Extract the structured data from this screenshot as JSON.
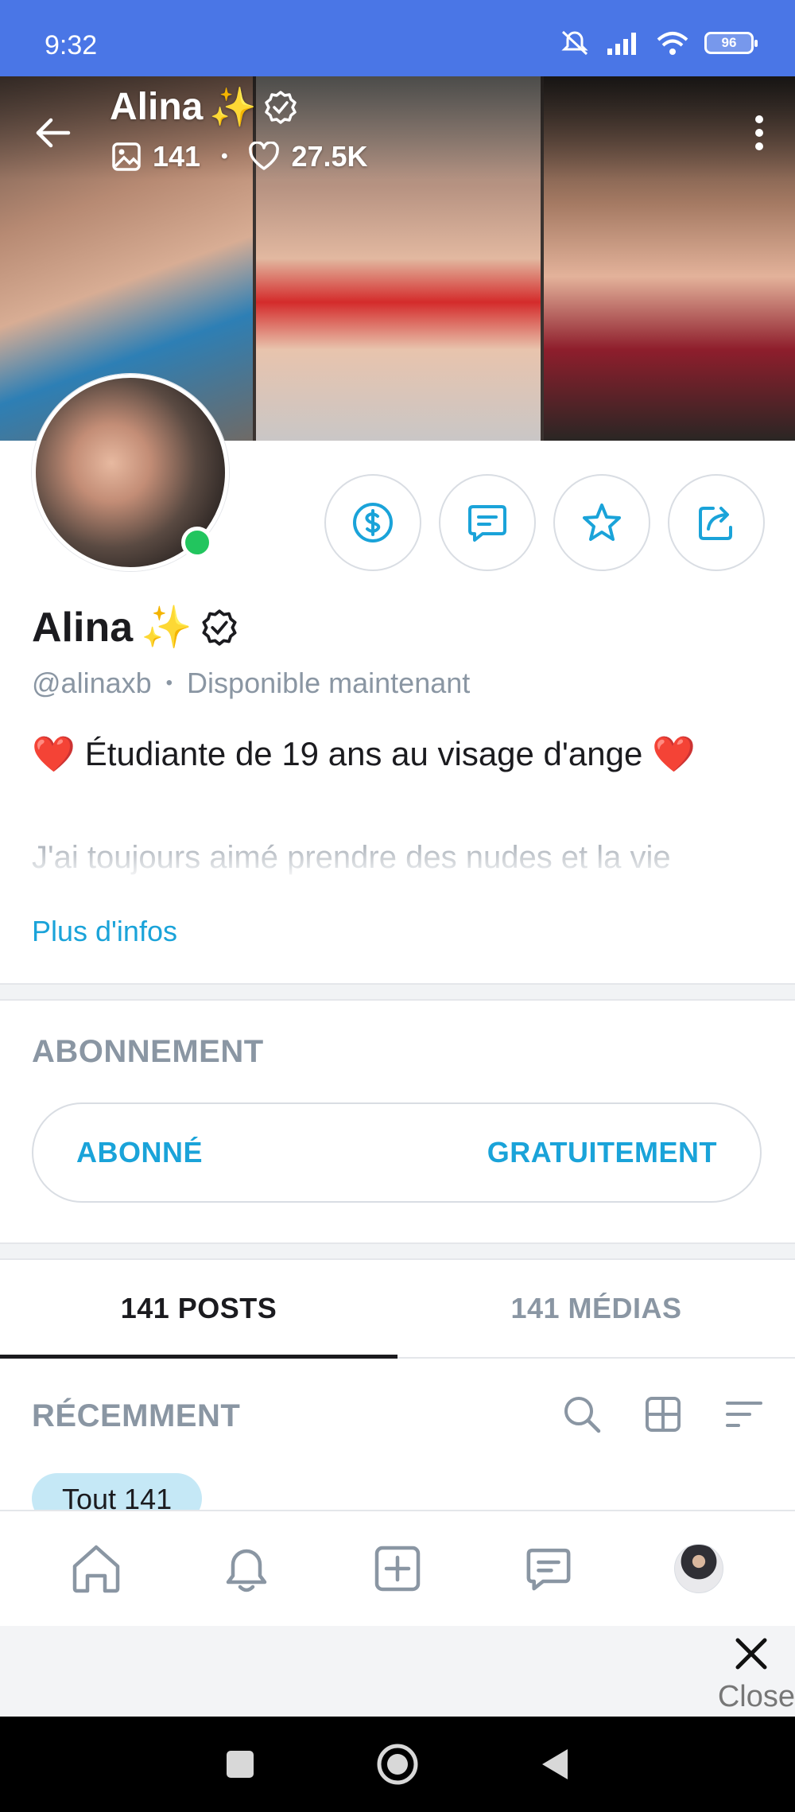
{
  "status_bar": {
    "time": "9:32",
    "battery": "96"
  },
  "cover": {
    "title": "Alina",
    "title_emoji": "✨",
    "posts_count": "141",
    "likes_count": "27.5K",
    "separator": "•"
  },
  "profile": {
    "name": "Alina",
    "name_emoji": "✨",
    "handle": "@alinaxb",
    "separator": "•",
    "availability": "Disponible maintenant",
    "bio_heart_left": "❤️",
    "bio_main": "Étudiante de 19 ans au visage d'ange",
    "bio_heart_right": "❤️",
    "bio_preview": "J'ai toujours aimé prendre des nudes et la vie",
    "more_info": "Plus d'infos",
    "online": true
  },
  "subscription": {
    "section_title": "ABONNEMENT",
    "status_label": "ABONNÉ",
    "price_label": "GRATUITEMENT"
  },
  "tabs": [
    {
      "label": "141 POSTS",
      "active": true
    },
    {
      "label": "141 MÉDIAS",
      "active": false
    }
  ],
  "feed": {
    "section_title": "RÉCEMMENT",
    "filter_chip": "Tout 141"
  },
  "overlay": {
    "close_label": "Close"
  },
  "colors": {
    "accent": "#1aa3d9",
    "status_bar": "#4a76e6",
    "online": "#22c55e",
    "muted": "#8a96a3"
  }
}
